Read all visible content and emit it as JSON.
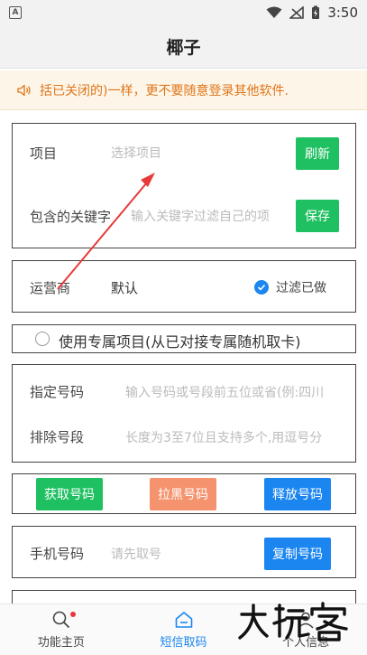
{
  "status": {
    "time": "3:50",
    "left_badge": "A"
  },
  "header": {
    "title": "椰子"
  },
  "notice": {
    "text": "括已关闭的)一样，更不要随意登录其他软件."
  },
  "project_card": {
    "project_label": "项目",
    "project_placeholder": "选择项目",
    "refresh_label": "刷新",
    "keyword_label": "包含的关键字",
    "keyword_placeholder": "输入关键字过滤自己的项",
    "save_label": "保存"
  },
  "operator_card": {
    "label": "运营商",
    "value": "默认",
    "filter_label": "过滤已做"
  },
  "exclusive": {
    "label": "使用专属项目(从已对接专属随机取卡)"
  },
  "number_card": {
    "specify_label": "指定号码",
    "specify_placeholder": "输入号码或号段前五位或省(例:四川",
    "exclude_label": "排除号段",
    "exclude_placeholder": "长度为3至7位且支持多个,用逗号分"
  },
  "actions": {
    "get_label": "获取号码",
    "blacklist_label": "拉黑号码",
    "release_label": "释放号码"
  },
  "phone_card": {
    "label": "手机号码",
    "placeholder": "请先取号",
    "copy_label": "复制号码"
  },
  "nav": {
    "home_label": "功能主页",
    "sms_label": "短信取码",
    "profile_label": "个人信息"
  },
  "colors": {
    "accent_blue": "#1b86f0",
    "green": "#1fc061",
    "orange": "#f4936d",
    "notice_text": "#e0751b"
  }
}
